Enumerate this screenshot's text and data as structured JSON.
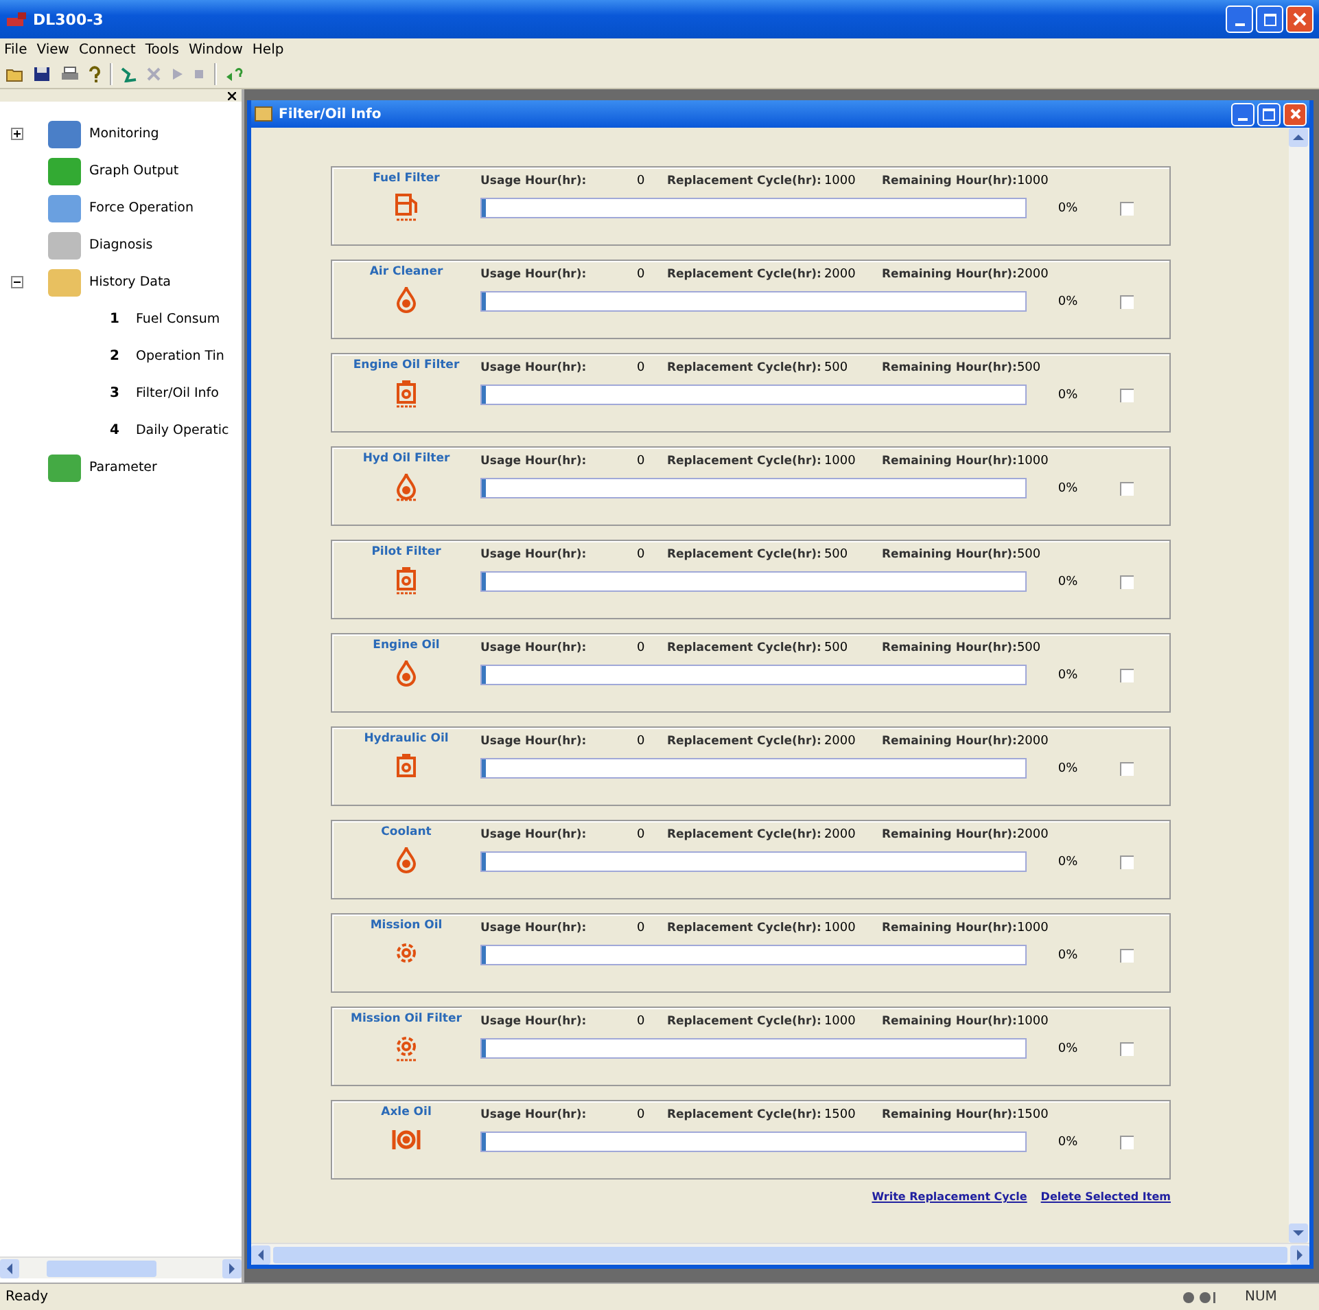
{
  "window": {
    "title": "DL300-3"
  },
  "menu": [
    "File",
    "View",
    "Connect",
    "Tools",
    "Window",
    "Help"
  ],
  "sidebar": {
    "items": [
      {
        "label": "Monitoring",
        "expanded": false
      },
      {
        "label": "Graph Output"
      },
      {
        "label": "Force Operation"
      },
      {
        "label": "Diagnosis"
      },
      {
        "label": "History Data",
        "expanded": true,
        "children": [
          {
            "number": "1",
            "label": "Fuel Consum"
          },
          {
            "number": "2",
            "label": "Operation Tin"
          },
          {
            "number": "3",
            "label": "Filter/Oil Info"
          },
          {
            "number": "4",
            "label": "Daily Operatic"
          }
        ]
      },
      {
        "label": "Parameter"
      }
    ]
  },
  "child_window": {
    "title": "Filter/Oil Info",
    "items": [
      {
        "name": "Fuel Filter",
        "usage_label": "Usage Hour(hr):",
        "usage": "0",
        "cycle_label": "Replacement Cycle(hr):",
        "cycle": "1000",
        "remaining_label": "Remaining Hour(hr):",
        "remaining": "1000",
        "level": 0,
        "percent": "0%",
        "checked": false
      },
      {
        "name": "Air Cleaner",
        "usage_label": "Usage Hour(hr):",
        "usage": "0",
        "cycle_label": "Replacement Cycle(hr):",
        "cycle": "2000",
        "remaining_label": "Remaining Hour(hr):",
        "remaining": "2000",
        "level": 0,
        "percent": "0%",
        "checked": false
      },
      {
        "name": "Engine Oil Filter",
        "usage_label": "Usage Hour(hr):",
        "usage": "0",
        "cycle_label": "Replacement Cycle(hr):",
        "cycle": "500",
        "remaining_label": "Remaining Hour(hr):",
        "remaining": "500",
        "level": 0,
        "percent": "0%",
        "checked": false
      },
      {
        "name": "Hyd Oil Filter",
        "usage_label": "Usage Hour(hr):",
        "usage": "0",
        "cycle_label": "Replacement Cycle(hr):",
        "cycle": "1000",
        "remaining_label": "Remaining Hour(hr):",
        "remaining": "1000",
        "level": 0,
        "percent": "0%",
        "checked": false
      },
      {
        "name": "Pilot Filter",
        "usage_label": "Usage Hour(hr):",
        "usage": "0",
        "cycle_label": "Replacement Cycle(hr):",
        "cycle": "500",
        "remaining_label": "Remaining Hour(hr):",
        "remaining": "500",
        "level": 0,
        "percent": "0%",
        "checked": false
      },
      {
        "name": "Engine Oil",
        "usage_label": "Usage Hour(hr):",
        "usage": "0",
        "cycle_label": "Replacement Cycle(hr):",
        "cycle": "500",
        "remaining_label": "Remaining Hour(hr):",
        "remaining": "500",
        "level": 0,
        "percent": "0%",
        "checked": false
      },
      {
        "name": "Hydraulic Oil",
        "usage_label": "Usage Hour(hr):",
        "usage": "0",
        "cycle_label": "Replacement Cycle(hr):",
        "cycle": "2000",
        "remaining_label": "Remaining Hour(hr):",
        "remaining": "2000",
        "level": 0,
        "percent": "0%",
        "checked": false
      },
      {
        "name": "Coolant",
        "usage_label": "Usage Hour(hr):",
        "usage": "0",
        "cycle_label": "Replacement Cycle(hr):",
        "cycle": "2000",
        "remaining_label": "Remaining Hour(hr):",
        "remaining": "2000",
        "level": 0,
        "percent": "0%",
        "checked": false
      },
      {
        "name": "Mission Oil",
        "usage_label": "Usage Hour(hr):",
        "usage": "0",
        "cycle_label": "Replacement Cycle(hr):",
        "cycle": "1000",
        "remaining_label": "Remaining Hour(hr):",
        "remaining": "1000",
        "level": 0,
        "percent": "0%",
        "checked": false
      },
      {
        "name": "Mission Oil Filter",
        "usage_label": "Usage Hour(hr):",
        "usage": "0",
        "cycle_label": "Replacement Cycle(hr):",
        "cycle": "1000",
        "remaining_label": "Remaining Hour(hr):",
        "remaining": "1000",
        "level": 0,
        "percent": "0%",
        "checked": false
      },
      {
        "name": "Axle Oil",
        "usage_label": "Usage Hour(hr):",
        "usage": "0",
        "cycle_label": "Replacement Cycle(hr):",
        "cycle": "1500",
        "remaining_label": "Remaining Hour(hr):",
        "remaining": "1500",
        "level": 0,
        "percent": "0%",
        "checked": false
      }
    ],
    "links": [
      "Write Replacement Cycle",
      "Delete Selected Item"
    ]
  },
  "status_bar": {
    "text": "Ready",
    "indicator": "NUM"
  }
}
